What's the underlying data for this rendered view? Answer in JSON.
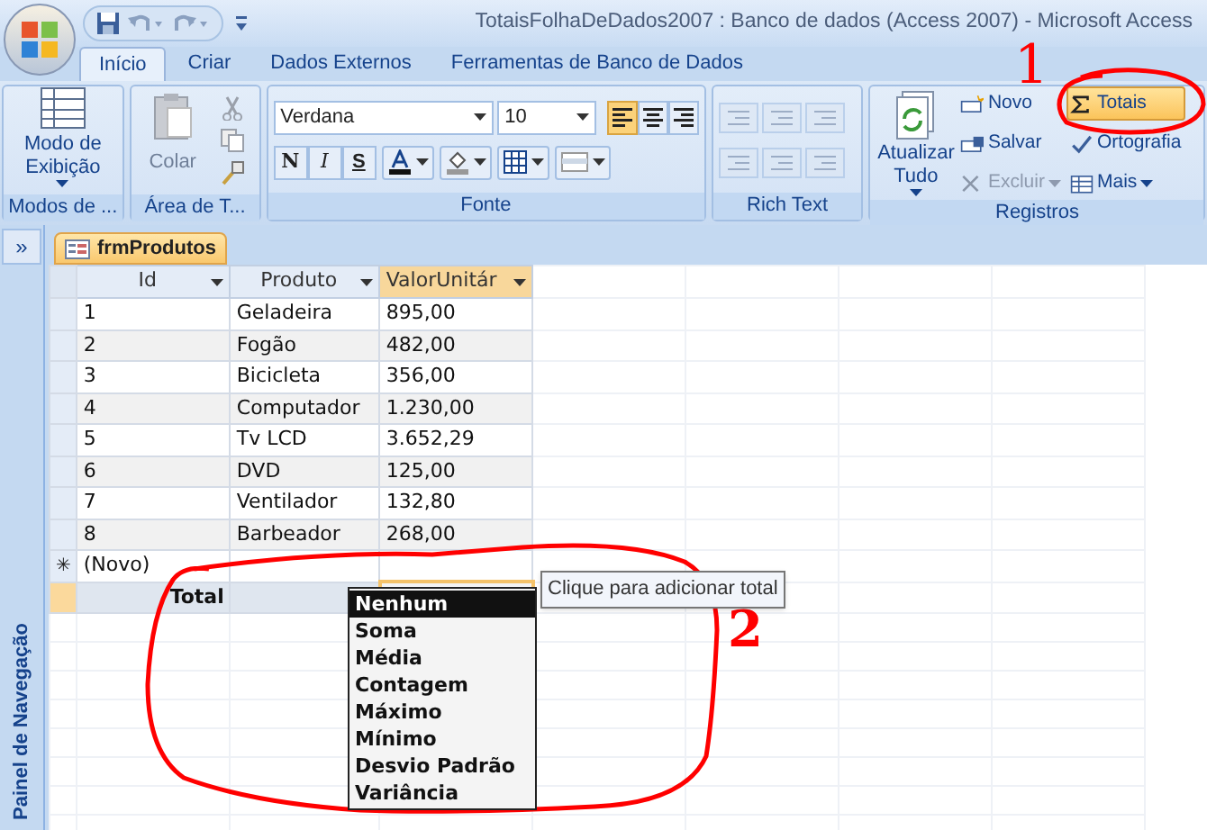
{
  "window": {
    "title": "TotaisFolhaDeDados2007 : Banco de dados (Access 2007) - Microsoft Access"
  },
  "tabs": [
    {
      "label": "Início",
      "selected": true
    },
    {
      "label": "Criar",
      "selected": false
    },
    {
      "label": "Dados Externos",
      "selected": false
    },
    {
      "label": "Ferramentas de Banco de Dados",
      "selected": false
    }
  ],
  "ribbon": {
    "views": {
      "label": "Modos de ...",
      "button": "Modo de Exibição"
    },
    "clipboard": {
      "label": "Área de T...",
      "paste": {
        "label": "Colar",
        "disabled": true
      }
    },
    "font": {
      "label": "Fonte",
      "family": "Verdana",
      "size": "10",
      "align": [
        {
          "selected": true
        },
        {
          "selected": false
        },
        {
          "selected": false
        }
      ],
      "styles": [
        "N",
        "I",
        "S"
      ]
    },
    "rich_text": {
      "label": "Rich Text"
    },
    "records": {
      "label": "Registros",
      "refresh": "Atualizar Tudo",
      "buttons": [
        {
          "label": "Novo",
          "disabled": false,
          "selected": false
        },
        {
          "label": "Salvar",
          "disabled": false,
          "selected": false
        },
        {
          "label": "Excluir",
          "disabled": true,
          "selected": false
        },
        {
          "label": "Totais",
          "disabled": false,
          "selected": true
        },
        {
          "label": "Ortografia",
          "disabled": false,
          "selected": false
        },
        {
          "label": "Mais",
          "disabled": false,
          "selected": false
        }
      ]
    }
  },
  "navigation_pane": {
    "toggle": "»",
    "label": "Painel de Navegação"
  },
  "datasheet": {
    "tab": "frmProdutos",
    "columns": [
      {
        "label": "Id",
        "selected": false
      },
      {
        "label": "Produto",
        "selected": false
      },
      {
        "label": "ValorUnitár",
        "selected": true
      }
    ],
    "rows": [
      [
        "1",
        "Geladeira",
        "895,00"
      ],
      [
        "2",
        "Fogão",
        "482,00"
      ],
      [
        "3",
        "Bicicleta",
        "356,00"
      ],
      [
        "4",
        "Computador",
        "1.230,00"
      ],
      [
        "5",
        "Tv LCD",
        "3.652,29"
      ],
      [
        "6",
        "DVD",
        "125,00"
      ],
      [
        "7",
        "Ventilador",
        "132,80"
      ],
      [
        "8",
        "Barbeador",
        "268,00"
      ]
    ],
    "new_row": {
      "marker": "✳",
      "label": "(Novo)"
    },
    "total_row": {
      "label": "Total"
    }
  },
  "total_menu": {
    "items": [
      {
        "label": "Nenhum",
        "selected": true
      },
      {
        "label": "Soma",
        "selected": false
      },
      {
        "label": "Média",
        "selected": false
      },
      {
        "label": "Contagem",
        "selected": false
      },
      {
        "label": "Máximo",
        "selected": false
      },
      {
        "label": "Mínimo",
        "selected": false
      },
      {
        "label": "Desvio Padrão",
        "selected": false
      },
      {
        "label": "Variância",
        "selected": false
      }
    ]
  },
  "tooltip": "Clique para adicionar total",
  "annotations": [
    "1",
    "2"
  ]
}
